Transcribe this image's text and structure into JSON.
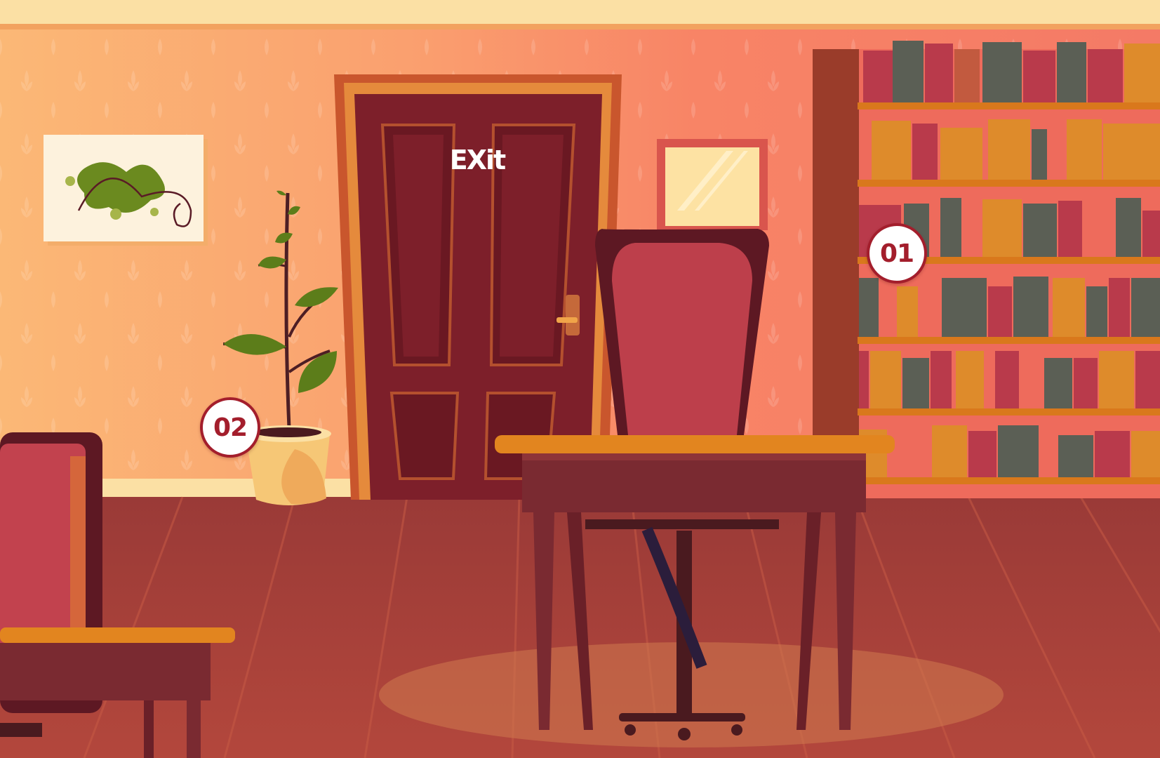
{
  "scene": {
    "exit_label": "EXit",
    "hotspots": [
      {
        "label": "01",
        "target": "bookshelf"
      },
      {
        "label": "02",
        "target": "potted-plant"
      }
    ]
  },
  "colors": {
    "wall_left": "#fbb173",
    "wall_right": "#f77d69",
    "floor": "#a8433c",
    "door": "#7d1f2a",
    "door_frame": "#c9562d",
    "shelf_wood": "#d9781c",
    "chair_seat": "#bd3f4b",
    "desk_top": "#e2851f",
    "hotspot_border": "#a31e2c"
  },
  "icons": [
    "abstract-painting-icon",
    "plant-icon",
    "door-icon",
    "mirror-icon",
    "bookshelf-icon",
    "chair-icon",
    "desk-icon"
  ]
}
